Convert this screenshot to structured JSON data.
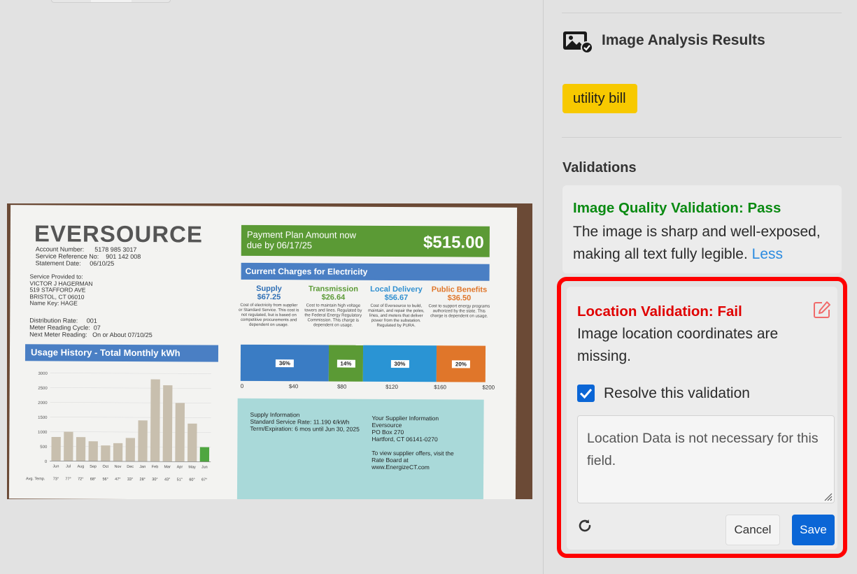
{
  "panel": {
    "title": "Image Analysis Results",
    "title_icon": "image-check-icon",
    "document_type_badge": "utility bill",
    "validations_heading": "Validations",
    "validations": [
      {
        "title": "Image Quality Validation: Pass",
        "status_color": "#0a8a12",
        "message": "The image is sharp and well-exposed, making all text fully legible.",
        "toggle_label": "Less"
      },
      {
        "title": "Location Validation: Fail",
        "status_color": "#e00000",
        "message": "Image location coordinates are missing.",
        "edit_icon": "edit-icon",
        "resolve_label": "Resolve this validation",
        "resolve_checked": true,
        "note_value": "Location Data is not necessary for this field.",
        "refresh_icon": "refresh-icon",
        "cancel_label": "Cancel",
        "save_label": "Save"
      }
    ]
  },
  "bill": {
    "logo": "EVERSOURCE",
    "account_block": "Account Number:      5178 985 3017\nService Reference No:    901 142 008\nStatement Date:     06/10/25",
    "service_block": "Service Provided to:\nVICTOR J HAGERMAN\n519 STAFFORD AVE\nBRISTOL, CT 06010\nName Key: HAGE",
    "distribution_block": "Distribution Rate:     001\nMeter Reading Cycle:  07\nNext Meter Reading:   On or About 07/10/25",
    "usage_title": "Usage History - Total Monthly kWh",
    "payment_label": "Payment Plan Amount now\ndue by 06/17/25",
    "payment_amount": "$515.00",
    "current_charges_title": "Current Charges for Electricity",
    "charges": [
      {
        "name": "Supply",
        "amount": "$67.25",
        "color": "#2f6fb5",
        "desc": "Cost of electricity from supplier or Standard Service. This cost is not regulated, but is based on competitive procurements and dependent on usage."
      },
      {
        "name": "Transmission",
        "amount": "$26.64",
        "color": "#5b9a35",
        "desc": "Cost to maintain high voltage towers and lines. Regulated by the Federal Energy Regulatory Commission. This charge is dependent on usage."
      },
      {
        "name": "Local Delivery",
        "amount": "$56.67",
        "color": "#2f8fd0",
        "desc": "Cost of Eversource to build, maintain, and repair the poles, lines, and meters that deliver power from the substation. Regulated by PURA."
      },
      {
        "name": "Public Benefits",
        "amount": "$36.50",
        "color": "#e0762a",
        "desc": "Cost to support energy programs authorized by the state. This charge is dependent on usage."
      }
    ],
    "pct_segments": [
      {
        "label": "36%",
        "value": 36,
        "color": "#3a7cc4"
      },
      {
        "label": "14%",
        "value": 14,
        "color": "#5b9a35"
      },
      {
        "label": "30%",
        "value": 30,
        "color": "#2a94d4"
      },
      {
        "label": "20%",
        "value": 20,
        "color": "#e0762a"
      }
    ],
    "pct_axis": [
      "0",
      "$40",
      "$80",
      "$120",
      "$160",
      "$200"
    ],
    "supply_info": "Supply Information\nStandard Service Rate: 11.190 ¢/kWh\nTerm/Expiration: 6 mos until Jun 30, 2025",
    "supplier_info": "Your Supplier Information\nEversource\nPO Box 270\nHartford, CT 06141-0270\n\nTo view supplier offers, visit the\nRate Board at\nwww.EnergizeCT.com"
  },
  "chart_data": {
    "type": "bar",
    "title": "Usage History - Total Monthly kWh",
    "categories": [
      "Jun",
      "Jul",
      "Aug",
      "Sep",
      "Oct",
      "Nov",
      "Dec",
      "Jan",
      "Feb",
      "Mar",
      "Apr",
      "May",
      "Jun"
    ],
    "values": [
      820,
      1000,
      820,
      680,
      540,
      620,
      800,
      1400,
      2800,
      2600,
      2000,
      1300,
      500
    ],
    "avg_temp_label": "Avg. Temp.",
    "avg_temps": [
      "73°",
      "77°",
      "72°",
      "68°",
      "56°",
      "47°",
      "33°",
      "28°",
      "30°",
      "43°",
      "51°",
      "60°",
      "67°"
    ],
    "yticks": [
      "3000",
      "2500",
      "2000",
      "1500",
      "1000",
      "500",
      "0"
    ],
    "ylim": [
      0,
      3000
    ],
    "colors": {
      "bar": "#c8bfae",
      "last_bar": "#4fa640"
    }
  }
}
